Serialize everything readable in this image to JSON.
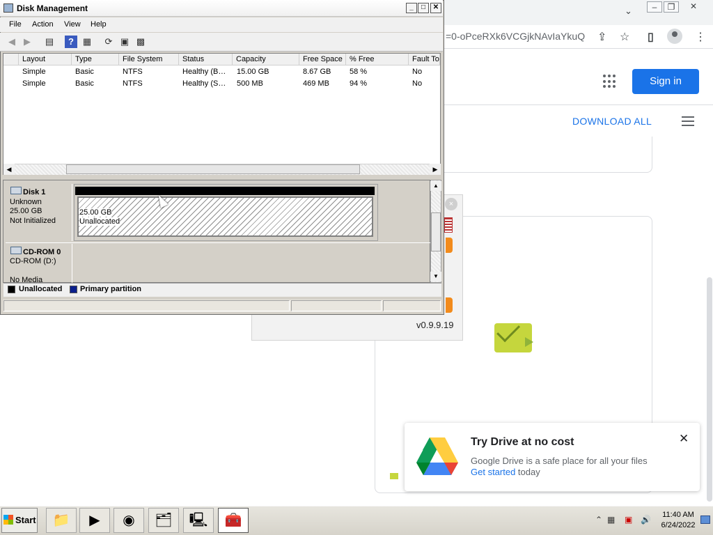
{
  "browser": {
    "url_fragment": "=0-oPceRXk6VCGjkNAvIaYkuQ",
    "win_min": "–",
    "win_max": "❐",
    "win_close": "✕",
    "chevron": "⌄",
    "share_icon": "⇪",
    "star_icon": "☆",
    "sidebar_icon": "▯",
    "menu_icon": "⋮"
  },
  "drive": {
    "sign_in": "Sign in",
    "download_all": "DOWNLOAD ALL"
  },
  "popup": {
    "close": "×",
    "version": "v0.9.9.19"
  },
  "promo": {
    "title": "Try Drive at no cost",
    "text": "Google Drive is a safe place for all your files",
    "link": "Get started",
    "link_suffix": " today",
    "close": "✕"
  },
  "dm": {
    "title": "Disk Management",
    "title_buttons": [
      "_",
      "□",
      "✕"
    ],
    "menu": [
      "File",
      "Action",
      "View",
      "Help"
    ],
    "columns": [
      "Layout",
      "Type",
      "File System",
      "Status",
      "Capacity",
      "Free Space",
      "% Free",
      "Fault Tol"
    ],
    "rows": [
      [
        "Simple",
        "Basic",
        "NTFS",
        "Healthy (B…",
        "15.00 GB",
        "8.67 GB",
        "58 %",
        "No"
      ],
      [
        "Simple",
        "Basic",
        "NTFS",
        "Healthy (S…",
        "500 MB",
        "469 MB",
        "94 %",
        "No"
      ]
    ],
    "disk1": {
      "name": "Disk 1",
      "type": "Unknown",
      "size": "25.00 GB",
      "state": "Not Initialized",
      "vol_size": "25.00 GB",
      "vol_label": "Unallocated"
    },
    "cdrom": {
      "name": "CD-ROM 0",
      "drive": "CD-ROM (D:)",
      "media": "No Media"
    },
    "legend": {
      "unallocated": "Unallocated",
      "primary": "Primary partition"
    }
  },
  "taskbar": {
    "start": "Start",
    "time": "11:40 AM",
    "date": "6/24/2022"
  }
}
